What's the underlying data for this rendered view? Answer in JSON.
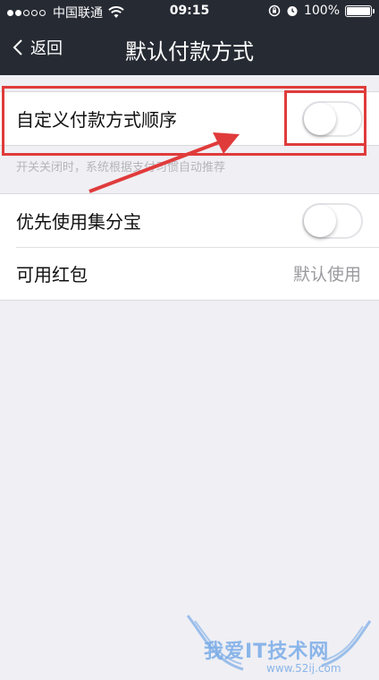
{
  "status_bar": {
    "carrier": "中国联通",
    "time": "09:15",
    "battery": "100%",
    "signal_dots_on": 2,
    "signal_dots_total": 5
  },
  "nav": {
    "back_label": "返回",
    "title": "默认付款方式"
  },
  "group1": {
    "custom_order_label": "自定义付款方式顺序",
    "custom_order_on": false,
    "hint": "开关关闭时，系统根据支付习惯自动推荐"
  },
  "group2": {
    "jifenbao_label": "优先使用集分宝",
    "jifenbao_on": false,
    "hongbao_label": "可用红包",
    "hongbao_value": "默认使用"
  },
  "watermark": {
    "text": "我爱IT技术网",
    "url": "www.52ij.com"
  },
  "colors": {
    "nav_bg": "#262a33",
    "page_bg": "#efeff4",
    "annotation": "#e03b3b",
    "watermark": "#78aae6"
  }
}
